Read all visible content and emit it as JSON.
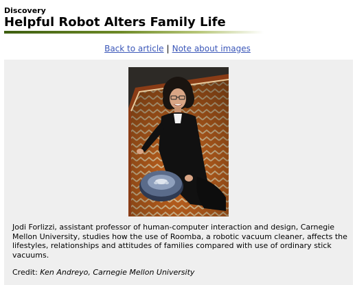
{
  "header": {
    "section": "Discovery",
    "title": "Helpful Robot Alters Family Life"
  },
  "nav": {
    "back_label": "Back to article",
    "separator": "|",
    "note_label": "Note about images"
  },
  "image": {
    "subject": "woman-with-robotic-vacuum-photo",
    "colors": {
      "background": "#2d2a26",
      "rug_orange": "#c8661f",
      "rug_cream": "#e8c99a",
      "clothing": "#111111",
      "robot": "#5a6b8a"
    }
  },
  "caption": {
    "text": "Jodi Forlizzi, assistant professor of human-computer interaction and design, Carnegie Mellon University, studies how the use of Roomba, a robotic vacuum cleaner, affects the lifestyles, relationships and attitudes of families compared with use of ordinary stick vacuums."
  },
  "credit": {
    "label": "Credit:",
    "name": "Ken Andreyo, Carnegie Mellon University"
  },
  "colors": {
    "link": "#3a56b8",
    "panel_bg": "#efefef",
    "rule_dark": "#3d5e10"
  }
}
